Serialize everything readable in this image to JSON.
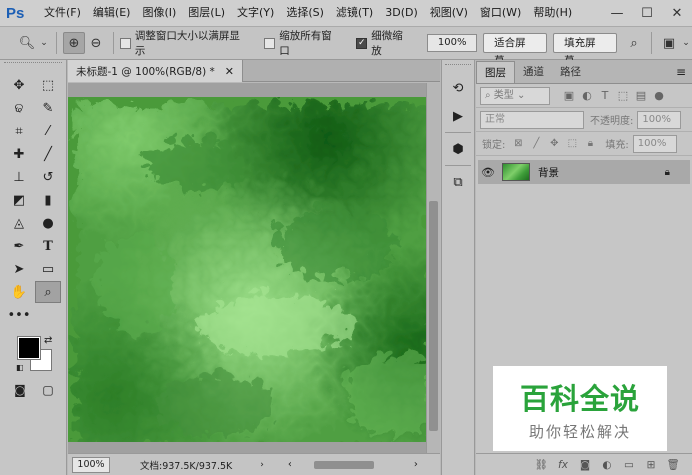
{
  "app": {
    "logo": "Ps",
    "menu": [
      "文件(F)",
      "编辑(E)",
      "图像(I)",
      "图层(L)",
      "文字(Y)",
      "选择(S)",
      "滤镜(T)",
      "3D(D)",
      "视图(V)",
      "窗口(W)",
      "帮助(H)"
    ],
    "window_controls": [
      "minimize-icon",
      "maximize-icon",
      "close-icon"
    ]
  },
  "options": {
    "resize_windows": "调整窗口大小以满屏显示",
    "zoom_all": "缩放所有窗口",
    "scrubby_zoom": "细微缩放",
    "scrubby_checked": true,
    "percent": "100%",
    "fit_screen": "适合屏幕",
    "fill_screen": "填充屏幕"
  },
  "document": {
    "tab_title": "未标题-1 @ 100%(RGB/8) *",
    "status_zoom": "100%",
    "status_info": "文档:937.5K/937.5K"
  },
  "layers_panel": {
    "tabs": [
      "图层",
      "通道",
      "路径"
    ],
    "filter_kind": "类型",
    "blend_mode": "正常",
    "opacity_label": "不透明度:",
    "opacity_value": "100%",
    "lock_label": "锁定:",
    "fill_label": "填充:",
    "fill_value": "100%",
    "layers": [
      {
        "name": "背景",
        "visible": true,
        "locked": true
      }
    ]
  },
  "watermark": {
    "title": "百科全说",
    "subtitle": "助你轻松解决"
  }
}
